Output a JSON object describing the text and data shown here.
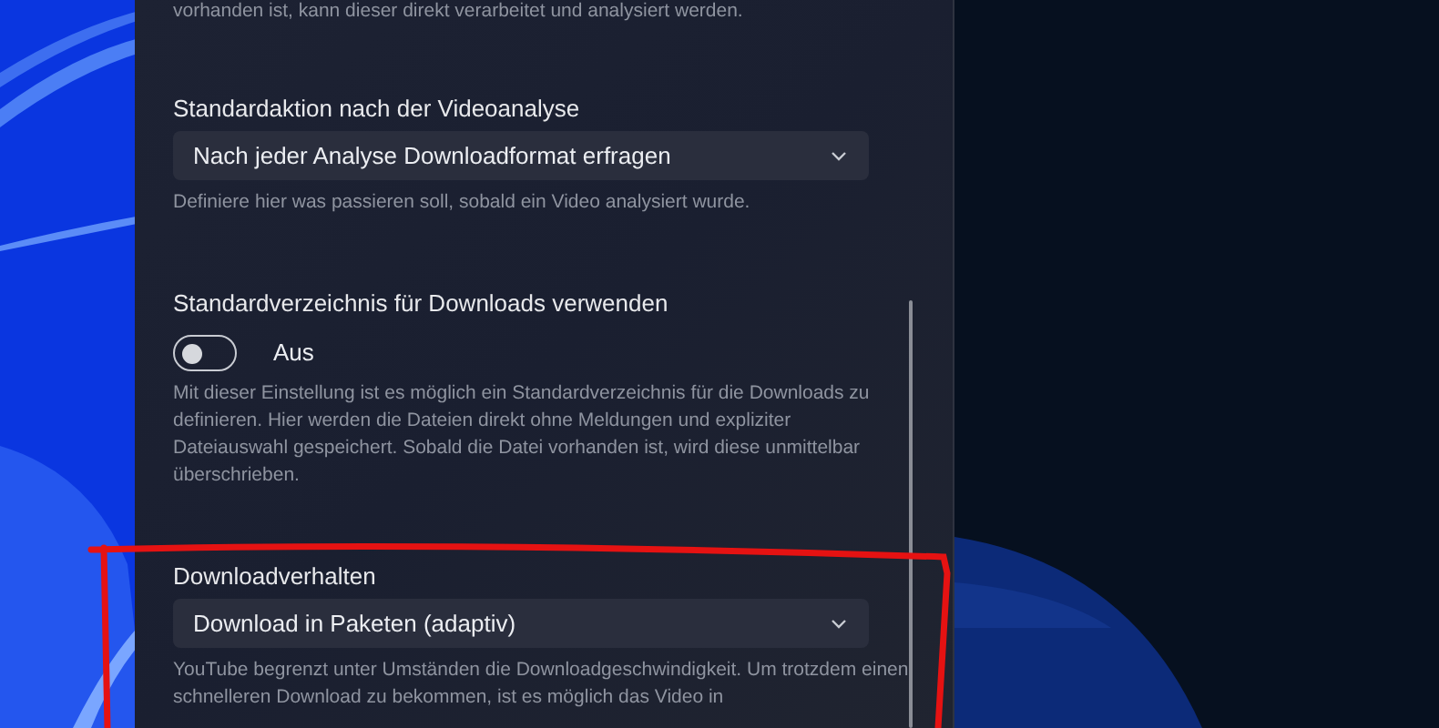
{
  "top_description_fragment": "vorhanden ist, kann dieser direkt verarbeitet und analysiert werden.",
  "settings": [
    {
      "kind": "dropdown",
      "label": "Standardaktion nach der Videoanalyse",
      "value": "Nach jeder Analyse Downloadformat erfragen",
      "description": "Definiere hier was passieren soll, sobald ein Video analysiert wurde."
    },
    {
      "kind": "toggle",
      "label": "Standardverzeichnis für Downloads verwenden",
      "on": false,
      "state_text": "Aus",
      "description": "Mit dieser Einstellung ist es möglich ein Standardverzeichnis für die Downloads zu definieren. Hier werden die Dateien direkt ohne Meldungen und expliziter Dateiauswahl gespeichert. Sobald die Datei vorhanden ist, wird diese unmittelbar überschrieben."
    },
    {
      "kind": "dropdown",
      "label": "Downloadverhalten",
      "value": "Download in Paketen (adaptiv)",
      "description": "YouTube begrenzt unter Umständen die Downloadgeschwindigkeit. Um trotzdem einen schnelleren Download zu bekommen, ist es möglich das Video in"
    }
  ]
}
